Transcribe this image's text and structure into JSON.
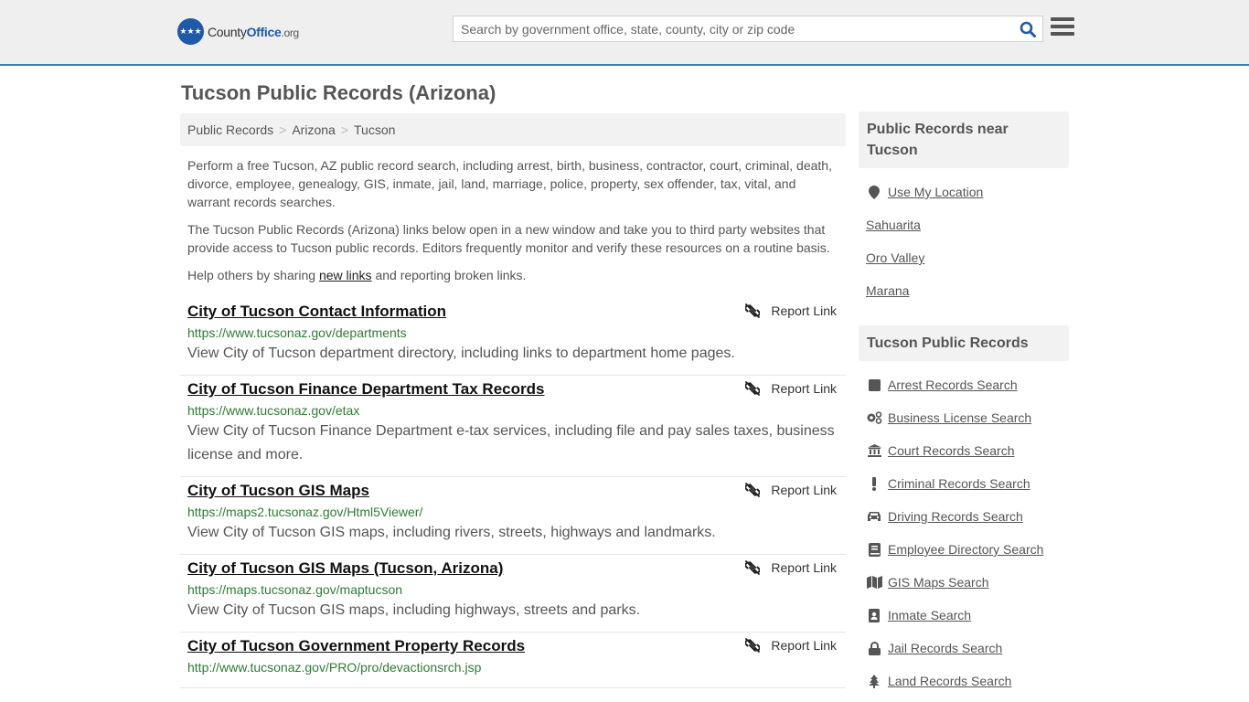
{
  "header": {
    "logo_text_pre": "County",
    "logo_text_bold": "Office",
    "logo_text_suffix": ".org",
    "search_placeholder": "Search by government office, state, county, city or zip code"
  },
  "page_title": "Tucson Public Records (Arizona)",
  "breadcrumb": [
    "Public Records",
    "Arizona",
    "Tucson"
  ],
  "intro": {
    "p1": "Perform a free Tucson, AZ public record search, including arrest, birth, business, contractor, court, criminal, death, divorce, employee, genealogy, GIS, inmate, jail, land, marriage, police, property, sex offender, tax, vital, and warrant records searches.",
    "p2": "The Tucson Public Records (Arizona) links below open in a new window and take you to third party websites that provide access to Tucson public records. Editors frequently monitor and verify these resources on a routine basis.",
    "p3_pre": "Help others by sharing ",
    "p3_link": "new links",
    "p3_post": " and reporting broken links."
  },
  "report_label": "Report Link",
  "records": [
    {
      "title": "City of Tucson Contact Information",
      "url": "https://www.tucsonaz.gov/departments",
      "desc": "View City of Tucson department directory, including links to department home pages."
    },
    {
      "title": "City of Tucson Finance Department Tax Records",
      "url": "https://www.tucsonaz.gov/etax",
      "desc": "View City of Tucson Finance Department e-tax services, including file and pay sales taxes, business license and more."
    },
    {
      "title": "City of Tucson GIS Maps",
      "url": "https://maps2.tucsonaz.gov/Html5Viewer/",
      "desc": "View City of Tucson GIS maps, including rivers, streets, highways and landmarks."
    },
    {
      "title": "City of Tucson GIS Maps (Tucson, Arizona)",
      "url": "https://maps.tucsonaz.gov/maptucson",
      "desc": "View City of Tucson GIS maps, including highways, streets and parks."
    },
    {
      "title": "City of Tucson Government Property Records",
      "url": "http://www.tucsonaz.gov/PRO/pro/devactionsrch.jsp",
      "desc": ""
    }
  ],
  "sidebar": {
    "near_title": "Public Records near Tucson",
    "use_location": "Use My Location",
    "nearby": [
      "Sahuarita",
      "Oro Valley",
      "Marana"
    ],
    "records_title": "Tucson Public Records",
    "links": [
      {
        "label": "Arrest Records Search",
        "icon": "square-icon"
      },
      {
        "label": "Business License Search",
        "icon": "gears-icon"
      },
      {
        "label": "Court Records Search",
        "icon": "courthouse-icon"
      },
      {
        "label": "Criminal Records Search",
        "icon": "exclamation-icon"
      },
      {
        "label": "Driving Records Search",
        "icon": "car-icon"
      },
      {
        "label": "Employee Directory Search",
        "icon": "book-icon"
      },
      {
        "label": "GIS Maps Search",
        "icon": "map-icon"
      },
      {
        "label": "Inmate Search",
        "icon": "id-badge-icon"
      },
      {
        "label": "Jail Records Search",
        "icon": "lock-icon"
      },
      {
        "label": "Land Records Search",
        "icon": "tree-icon"
      }
    ]
  }
}
